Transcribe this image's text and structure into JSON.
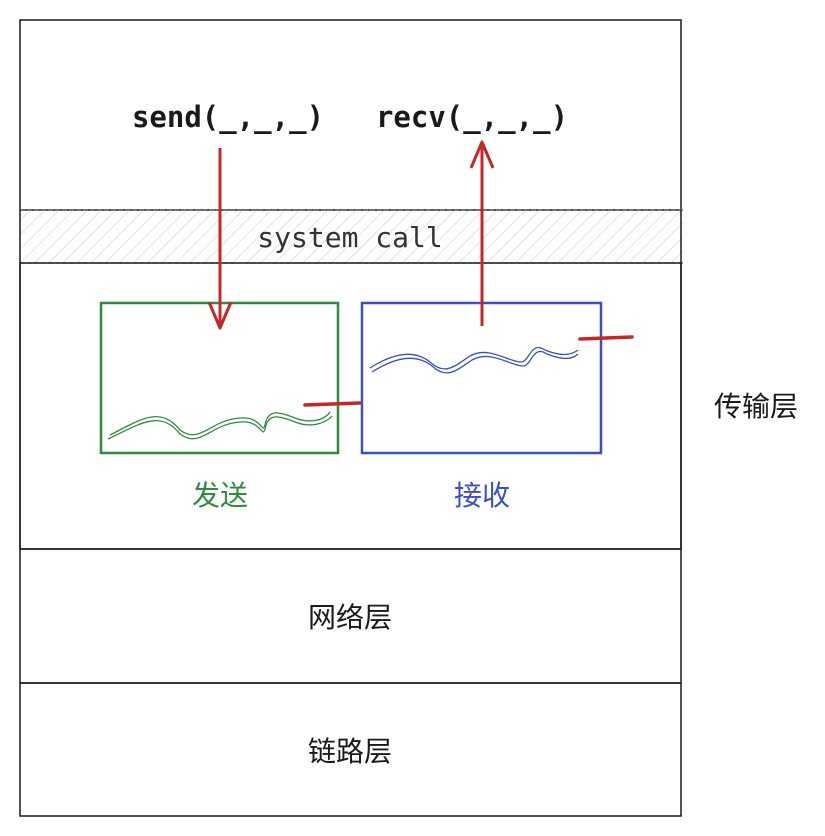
{
  "app_layer": {
    "send_call": "send(_,_,_)",
    "recv_call": "recv(_,_,_)"
  },
  "system_call": {
    "label": "system call"
  },
  "transport_layer": {
    "label": "传输层",
    "send_buffer": {
      "label": "发送",
      "color": "#2e8b3e"
    },
    "recv_buffer": {
      "label": "接收",
      "color": "#3b4fc4"
    }
  },
  "network_layer": {
    "label": "网络层"
  },
  "link_layer": {
    "label": "链路层"
  },
  "colors": {
    "arrow": "#c62828",
    "border": "#1a1a1a",
    "hatch": "#c8c8c8",
    "text": "#1a1a1a"
  }
}
